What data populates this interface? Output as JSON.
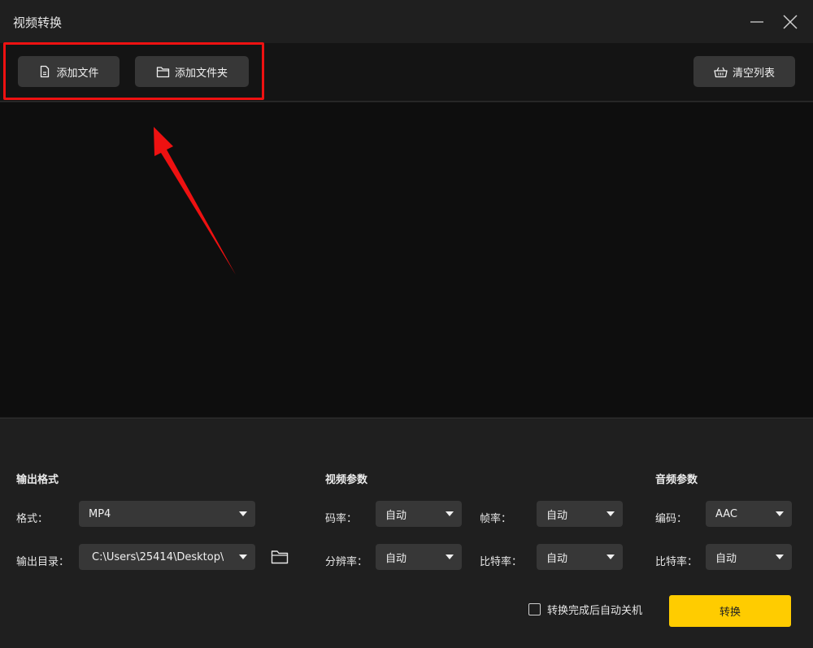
{
  "window": {
    "title": "视频转换",
    "minimize_icon": "minimize-icon",
    "close_icon": "close-icon"
  },
  "toolbar": {
    "add_file_label": "添加文件",
    "add_file_icon": "document-icon",
    "add_folder_label": "添加文件夹",
    "add_folder_icon": "folder-icon",
    "clear_label": "清空列表",
    "clear_icon": "basket-icon"
  },
  "annotation": {
    "highlight_color": "#ee1111"
  },
  "output": {
    "section_title": "输出格式",
    "format_label": "格式：",
    "format_value": "MP4",
    "dir_label": "输出目录：",
    "dir_value": "C:\\Users\\25414\\Desktop\\",
    "folder_icon": "folder-icon"
  },
  "video": {
    "section_title": "视频参数",
    "bitrate_label": "码率：",
    "bitrate_value": "自动",
    "framerate_label": "帧率：",
    "framerate_value": "自动",
    "resolution_label": "分辨率：",
    "resolution_value": "自动",
    "vbitrate_label": "比特率：",
    "vbitrate_value": "自动"
  },
  "audio": {
    "section_title": "音频参数",
    "codec_label": "编码：",
    "codec_value": "AAC",
    "abitrate_label": "比特率：",
    "abitrate_value": "自动"
  },
  "footer": {
    "shutdown_label": "转换完成后自动关机",
    "shutdown_checked": false,
    "convert_label": "转换",
    "convert_color": "#ffcc00"
  }
}
